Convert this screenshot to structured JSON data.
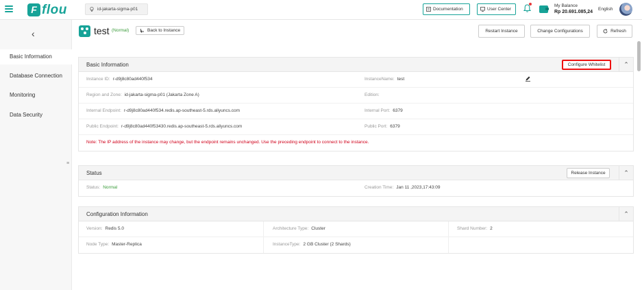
{
  "topbar": {
    "brand": "flou",
    "brand_letter": "F",
    "region": "id-jakarta-sigma-p01",
    "documentation": "Documentation",
    "user_center": "User Center",
    "balance_label": "My Balance",
    "balance_value": "Rp 20.691.085,24",
    "language": "English"
  },
  "sidebar": {
    "items": [
      {
        "label": "Basic Information"
      },
      {
        "label": "Database Connection"
      },
      {
        "label": "Monitoring"
      },
      {
        "label": "Data Security"
      }
    ]
  },
  "instance": {
    "name": "test",
    "status": "(Normal)",
    "back_label": "Back to Instance",
    "actions": {
      "restart": "Restart Instance",
      "change": "Change Configurations",
      "refresh": "Refresh"
    }
  },
  "basic": {
    "title": "Basic Information",
    "configure_whitelist": "Configure Whitelist",
    "instance_id_k": "Instance ID:",
    "instance_id_v": "r-d9j8c80ad440f534",
    "instance_name_k": "InstanceName:",
    "instance_name_v": "test",
    "region_k": "Region and Zone:",
    "region_v": "id-jakarta-sigma-p01 (Jakarta Zone A)",
    "edition_k": "Edition:",
    "internal_ep_k": "Internal Endpoint:",
    "internal_ep_v": "r-d9j8c80ad440f534.redis.ap-southeast-5.rds.aliyuncs.com",
    "internal_port_k": "Internal Port:",
    "internal_port_v": "6379",
    "public_ep_k": "Public Endpoint:",
    "public_ep_v": "r-d9j8c80ad440f53430.redis.ap-southeast-5.rds.aliyuncs.com",
    "public_port_k": "Public Port:",
    "public_port_v": "6379",
    "note": "Note:  The IP address of the instance may change, but the endpoint remains unchanged. Use the preceding endpoint to connect to the instance."
  },
  "status": {
    "title": "Status",
    "release": "Release Instance",
    "status_k": "Status:",
    "status_v": "Normal",
    "created_k": "Creation Time:",
    "created_v": "Jan 11 ,2023,17:43:09"
  },
  "config": {
    "title": "Configuration Information",
    "version_k": "Version:",
    "version_v": "Redis 5.0",
    "arch_k": "Architecture Type:",
    "arch_v": "Cluster",
    "shard_k": "Shard Number:",
    "shard_v": "2",
    "node_k": "Node Type:",
    "node_v": "Master-Replica",
    "itype_k": "InstanceType:",
    "itype_v": "2 GB Cluster (2 Shards)"
  }
}
